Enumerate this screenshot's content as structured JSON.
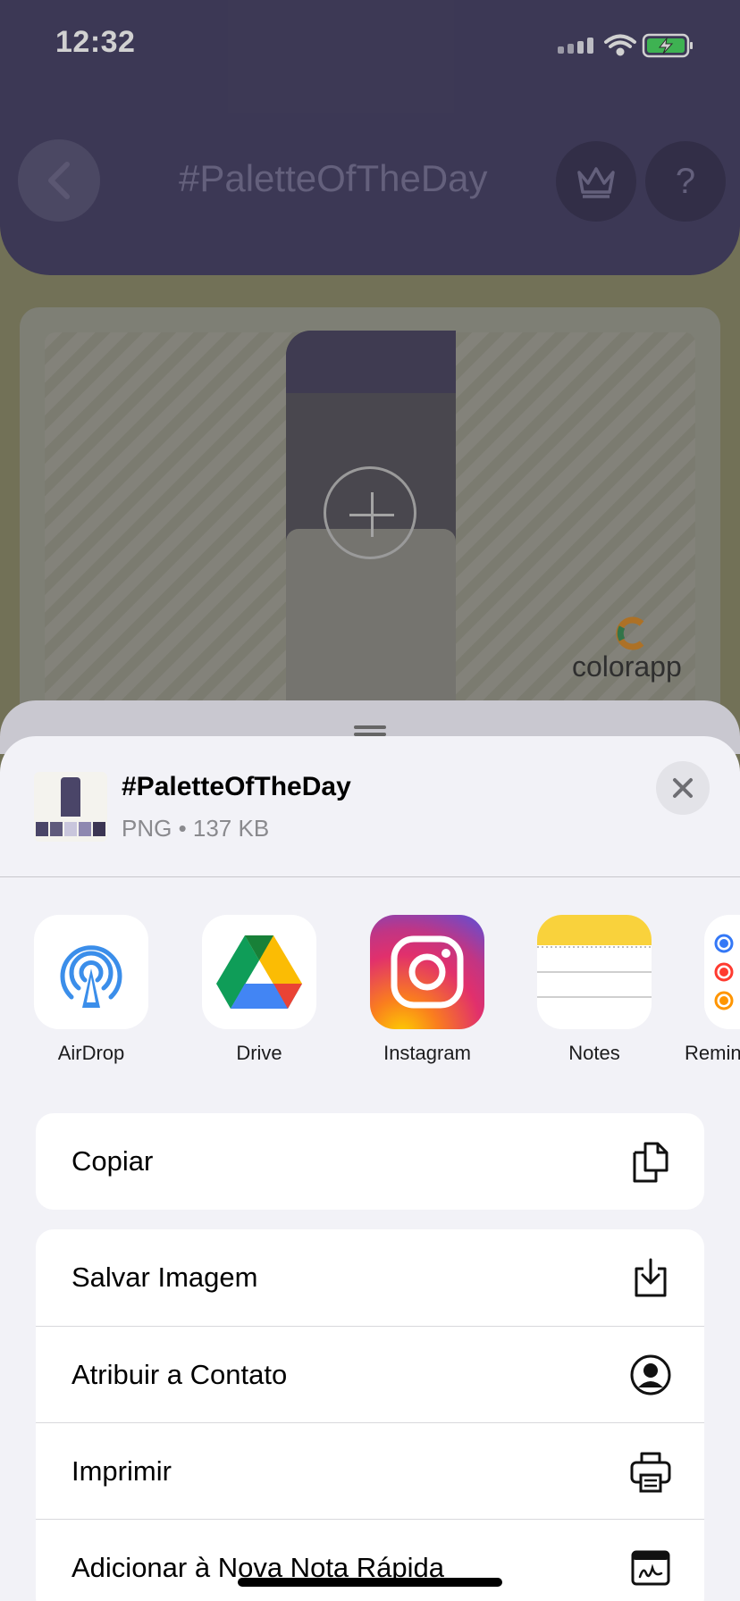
{
  "status_bar": {
    "time": "12:32"
  },
  "header": {
    "title": "#PaletteOfTheDay",
    "help_label": "?"
  },
  "preview": {
    "brand_name": "colorapp"
  },
  "share": {
    "title": "#PaletteOfTheDay",
    "subtitle": "PNG • 137 KB",
    "apps": [
      {
        "label": "AirDrop",
        "icon": "airdrop-icon"
      },
      {
        "label": "Drive",
        "icon": "google-drive-icon"
      },
      {
        "label": "Instagram",
        "icon": "instagram-icon"
      },
      {
        "label": "Notes",
        "icon": "notes-icon"
      },
      {
        "label": "Reminders",
        "icon": "reminders-icon"
      }
    ],
    "actions_primary": [
      {
        "label": "Copiar",
        "icon": "copy-icon"
      }
    ],
    "actions_secondary": [
      {
        "label": "Salvar Imagem",
        "icon": "save-download-icon"
      },
      {
        "label": "Atribuir a Contato",
        "icon": "person-circle-icon"
      },
      {
        "label": "Imprimir",
        "icon": "printer-icon"
      },
      {
        "label": "Adicionar à Nova Nota Rápida",
        "icon": "quick-note-icon"
      }
    ]
  },
  "colors": {
    "header_purple": "#4a4568",
    "sheet_bg": "#f2f2f7",
    "accent_blue": "#3478f6"
  }
}
